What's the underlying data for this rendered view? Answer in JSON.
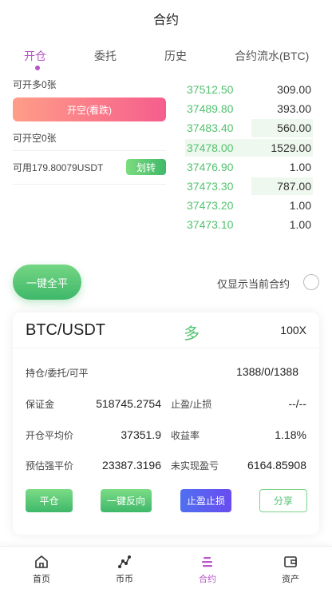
{
  "header": {
    "title": "合约"
  },
  "tabs": [
    {
      "label": "开仓",
      "active": true
    },
    {
      "label": "委托",
      "active": false
    },
    {
      "label": "历史",
      "active": false
    },
    {
      "label": "合约流水(BTC)",
      "active": false
    }
  ],
  "trade": {
    "can_open_long": "可开多0张",
    "open_short_button": "开空(看跌)",
    "can_open_short": "可开空0张",
    "available": "可用179.80079USDT",
    "transfer_button": "划转"
  },
  "order_book": [
    {
      "price": "37512.50",
      "qty": "309.00",
      "depth": 0
    },
    {
      "price": "37489.80",
      "qty": "393.00",
      "depth": 0
    },
    {
      "price": "37483.40",
      "qty": "560.00",
      "depth": 0.48
    },
    {
      "price": "37478.00",
      "qty": "1529.00",
      "depth": 1.0
    },
    {
      "price": "37476.90",
      "qty": "1.00",
      "depth": 0
    },
    {
      "price": "37473.30",
      "qty": "787.00",
      "depth": 0.48
    },
    {
      "price": "37473.20",
      "qty": "1.00",
      "depth": 0
    },
    {
      "price": "37473.10",
      "qty": "1.00",
      "depth": 0
    }
  ],
  "controls": {
    "close_all_button": "一键全平",
    "only_current_label": "仅显示当前合约"
  },
  "position": {
    "pair": "BTC/USDT",
    "direction": "多",
    "leverage": "100X",
    "hold_label": "持仓/委托/可平",
    "hold_value": "1388/0/1388",
    "margin_label": "保证金",
    "margin_value": "518745.2754",
    "tpsl_label": "止盈/止损",
    "tpsl_value": "--/--",
    "avg_price_label": "开仓平均价",
    "avg_price_value": "37351.9",
    "yield_label": "收益率",
    "yield_value": "1.18%",
    "liq_price_label": "预估强平价",
    "liq_price_value": "23387.3196",
    "unrealized_label": "未实现盈亏",
    "unrealized_value": "6164.85908",
    "actions": {
      "close": "平仓",
      "reverse": "一键反向",
      "tpsl": "止盈止损",
      "share": "分享"
    }
  },
  "tabbar": [
    {
      "label": "首页",
      "icon": "home-icon",
      "active": false
    },
    {
      "label": "币币",
      "icon": "chart-icon",
      "active": false
    },
    {
      "label": "合约",
      "icon": "contract-icon",
      "active": true
    },
    {
      "label": "资产",
      "icon": "wallet-icon",
      "active": false
    }
  ],
  "colors": {
    "accent": "#b855c8",
    "up": "#52c26f",
    "down": "#f55e8c"
  }
}
